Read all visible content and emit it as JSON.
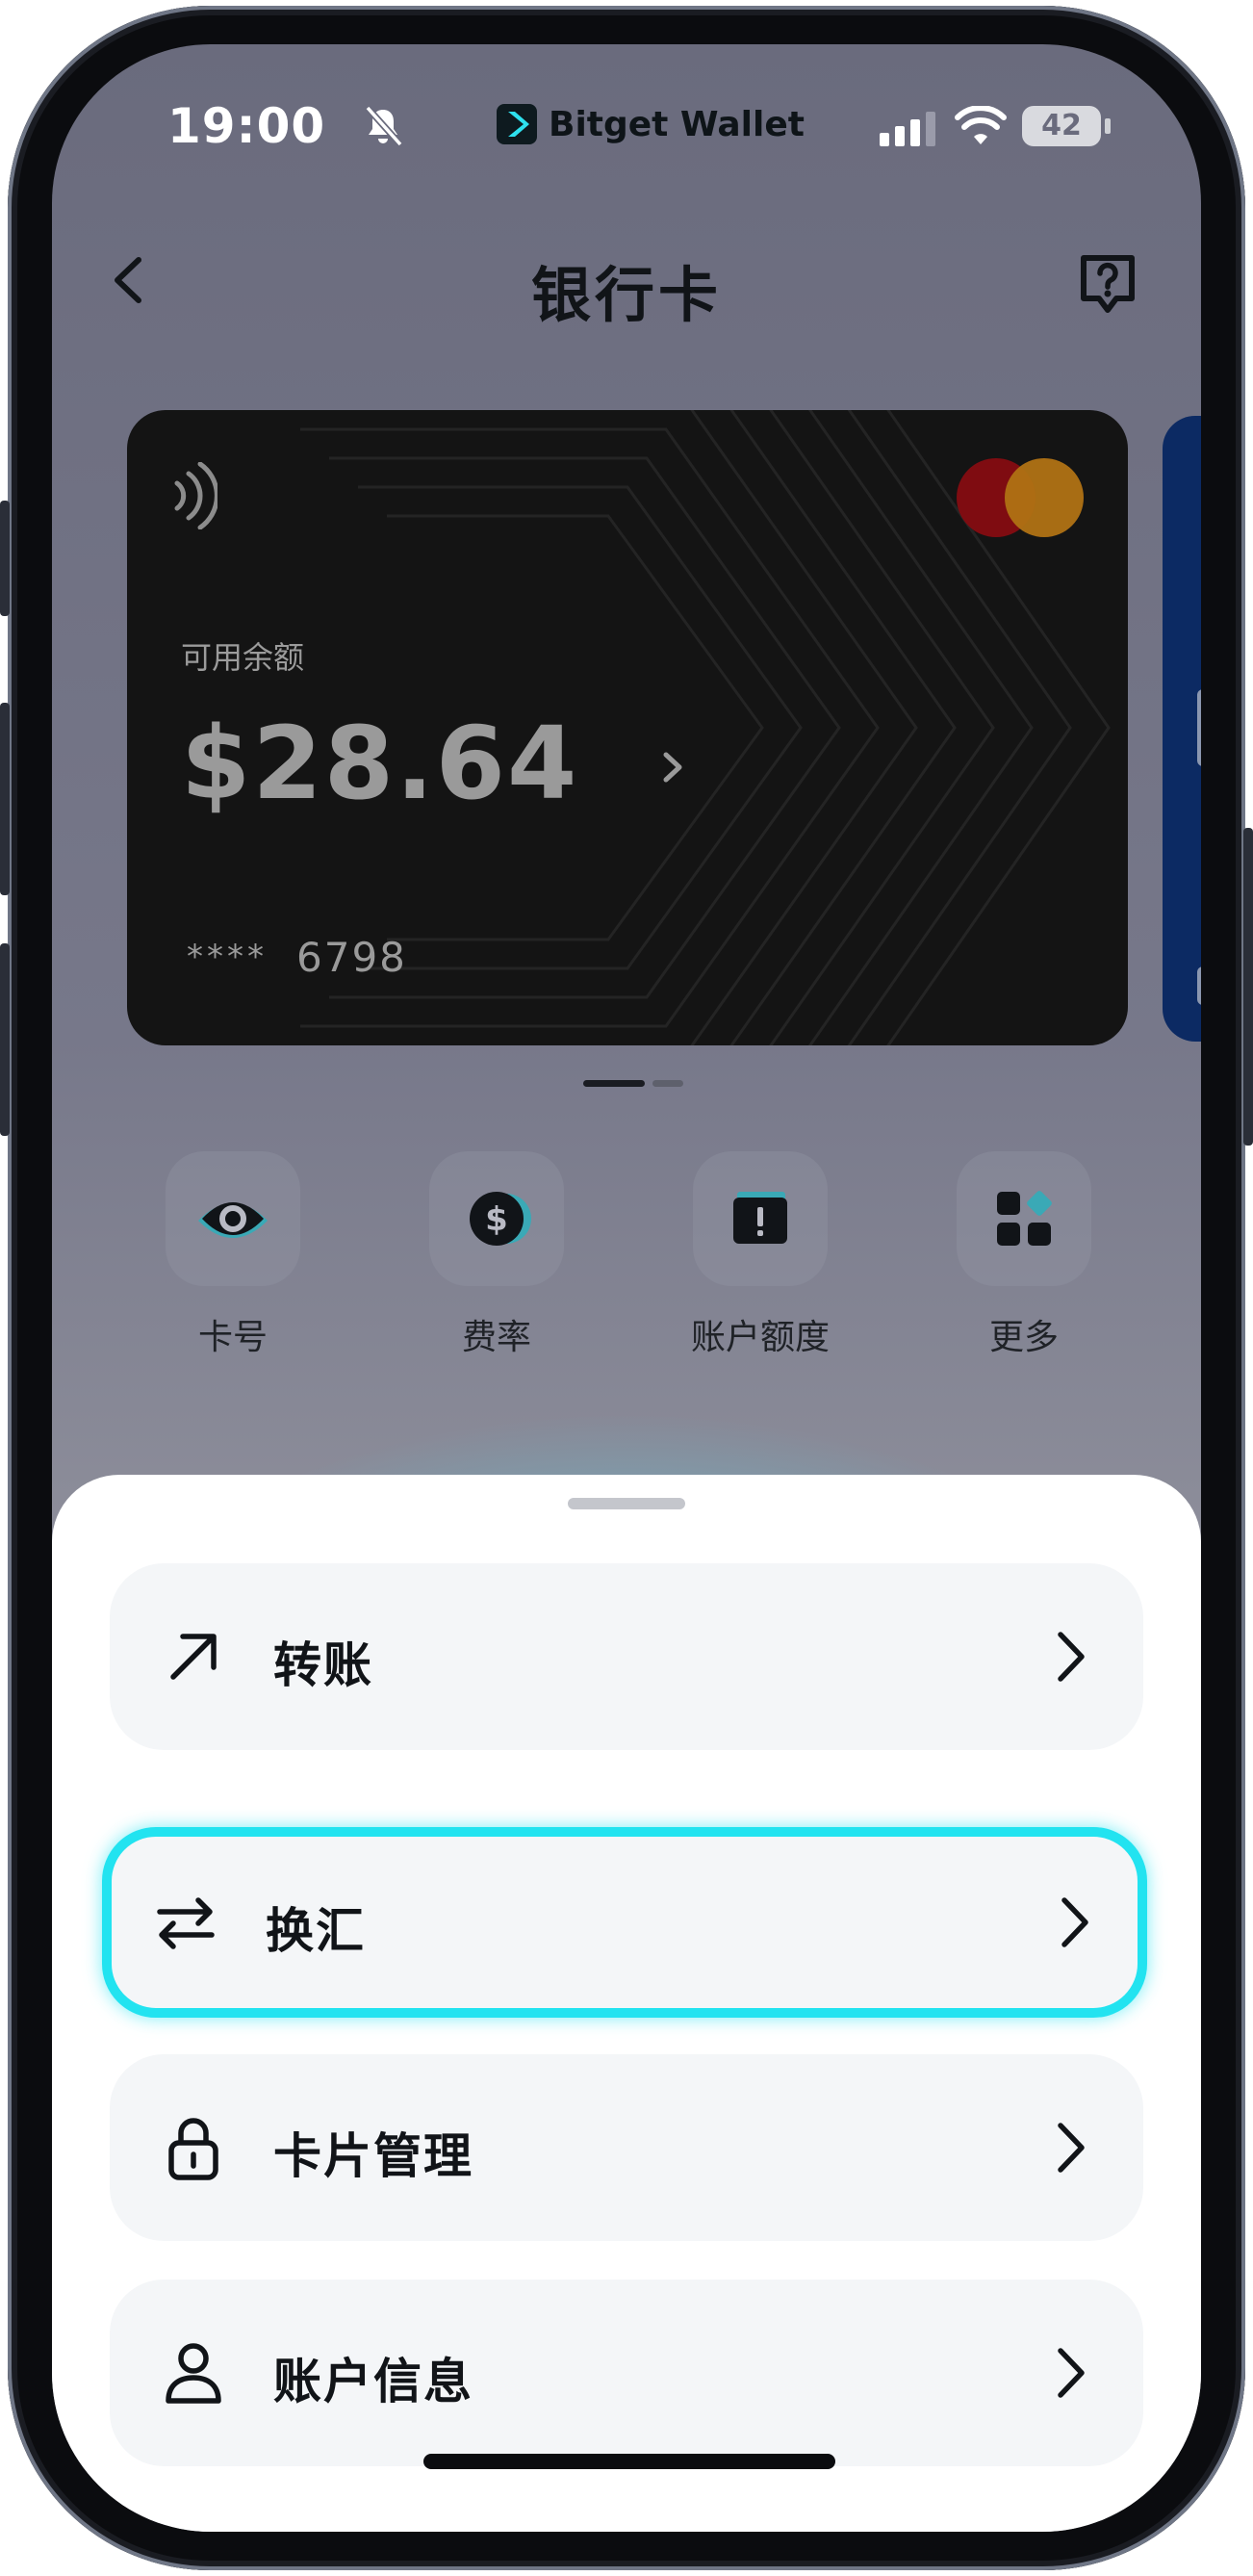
{
  "status_bar": {
    "time": "19:00",
    "brand": "Bitget Wallet",
    "battery": "42",
    "icons": [
      "bell-slash-icon",
      "signal-icon",
      "wifi-icon",
      "battery-icon"
    ]
  },
  "header": {
    "title": "银行卡",
    "back_icon": "chevron-left-icon",
    "help_icon": "help-chat-icon"
  },
  "card": {
    "balance_label": "可用余额",
    "balance": "$28.64",
    "masked": "****",
    "last4": "6798",
    "brand_colors": {
      "mastercard_left": "#7f0c11",
      "mastercard_right": "#b07214"
    }
  },
  "pagination": {
    "active": 1,
    "total": 2
  },
  "quick_actions": [
    {
      "label": "卡号",
      "icon": "eye-icon"
    },
    {
      "label": "费率",
      "icon": "dollar-coin-icon"
    },
    {
      "label": "账户额度",
      "icon": "alert-wallet-icon"
    },
    {
      "label": "更多",
      "icon": "grid-more-icon"
    }
  ],
  "menu": [
    {
      "label": "转账",
      "icon": "arrow-up-right-icon",
      "selected": false
    },
    {
      "label": "换汇",
      "icon": "swap-arrows-icon",
      "selected": true
    },
    {
      "label": "卡片管理",
      "icon": "lock-icon",
      "selected": false
    },
    {
      "label": "账户信息",
      "icon": "user-icon",
      "selected": false
    }
  ],
  "colors": {
    "accent": "#22e3f0",
    "sheet_item_bg": "#f4f6f8",
    "text_primary": "#111418"
  }
}
